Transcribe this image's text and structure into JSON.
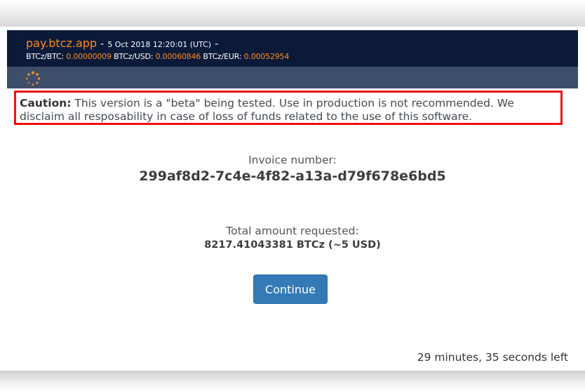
{
  "header": {
    "site_name": "pay.btcz.app",
    "separator": "-",
    "timestamp": "5 Oct 2018 12:20:01 (UTC)",
    "trailing_separator": "-",
    "rates": [
      {
        "label": "BTCz/BTC:",
        "value": "0.00000009"
      },
      {
        "label": "BTCz/USD:",
        "value": "0.00060846"
      },
      {
        "label": "BTCz/EUR:",
        "value": "0.00052954"
      }
    ],
    "accent_color": "#ff8a1f",
    "background_color": "#0c1a3a"
  },
  "subbar": {
    "spinner_icon": "loading-spinner-icon",
    "background_color": "#3c4e6a"
  },
  "caution": {
    "label": "Caution:",
    "message": "This version is a \"beta\" being tested. Use in production is not recommended. We disclaim all resposability in case of loss of funds related to the use of this software.",
    "border_color": "#ee1111"
  },
  "invoice": {
    "label": "Invoice number:",
    "number": "299af8d2-7c4e-4f82-a13a-d79f678e6bd5"
  },
  "amount": {
    "label": "Total amount requested:",
    "value": "8217.41043381 BTCz (~5 USD)"
  },
  "actions": {
    "continue_label": "Continue",
    "button_color": "#337ab7"
  },
  "timer": {
    "text": "29 minutes, 35 seconds left"
  }
}
